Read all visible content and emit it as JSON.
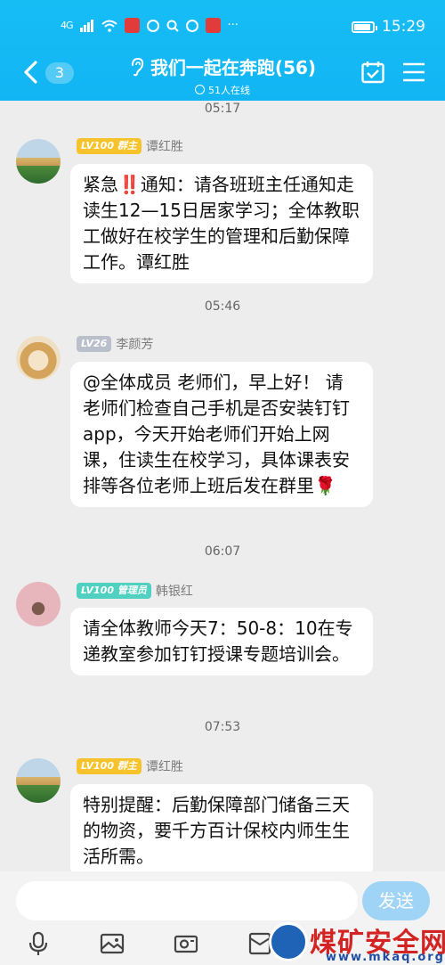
{
  "status_bar": {
    "signal": "4G",
    "time": "15:29",
    "more": "···"
  },
  "header": {
    "back_count": "3",
    "title": "我们一起在奔跑(56)",
    "online": "51人在线"
  },
  "messages": [
    {
      "time": "05:17",
      "level": "LV100",
      "role": "群主",
      "sender": "谭红胜",
      "text": "紧急‼️通知：请各班班主任通知走读生12—15日居家学习；全体教职工做好在校学生的管理和后勤保障工作。谭红胜"
    },
    {
      "time": "05:46",
      "level": "LV26",
      "role": "",
      "sender": "李颜芳",
      "text": "@全体成员 老师们，早上好！ 请老师们检查自己手机是否安装钉钉app，今天开始老师们开始上网课，住读生在校学习，具体课表安排等各位老师上班后发在群里🌹"
    },
    {
      "time": "06:07",
      "level": "LV100",
      "role": "管理员",
      "sender": "韩银红",
      "text": "请全体教师今天7：50-8：10在专递教室参加钉钉授课专题培训会。"
    },
    {
      "time": "07:53",
      "level": "LV100",
      "role": "群主",
      "sender": "谭红胜",
      "text": "特别提醒：后勤保障部门储备三天的物资，要千方百计保校内师生生活所需。"
    }
  ],
  "input": {
    "placeholder": "",
    "send_label": "发送"
  },
  "watermark": {
    "name": "煤矿安全网",
    "url": "www.mkaq.org"
  },
  "colors": {
    "header": "#12b5f3",
    "send": "#9fd4f6",
    "owner_badge": "#f7c32c",
    "admin_badge": "#4fd0c0"
  }
}
